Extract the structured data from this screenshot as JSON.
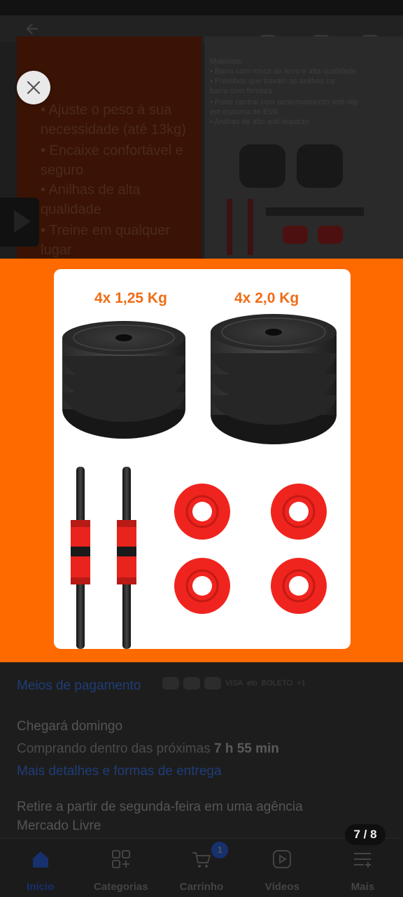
{
  "background": {
    "promo_lines": [
      "• Ajuste o peso à sua",
      "necessidade (até 13kg)",
      "• Encaixe confortável e",
      "seguro",
      "• Anilhas de alta",
      "qualidade",
      "• Treine em qualquer",
      "lugar"
    ],
    "spec_lines": [
      "Materiais:",
      "• Barra com rosca de ferro e alta qualidade",
      "• Presilhas que travam as anilhas na",
      "barra com firmeza",
      "• Parte central com acolchoamento anti-slip",
      "em espuma de EVA",
      "• Anilhas de alto anti-impacto"
    ],
    "payment_link": "Meios de pagamento",
    "payment_icons_text": [
      "VISA",
      "elo",
      "BOLETO",
      "+1"
    ],
    "delivery_title": "Chegará domingo",
    "delivery_prefix": "Comprando dentro das próximas",
    "delivery_time": "7 h 55 min",
    "delivery_link": "Mais detalhes e formas de entrega",
    "pickup_line1": "Retire a partir de segunda-feira em uma agência",
    "pickup_line2": "Mercado Livre"
  },
  "bottom_nav": {
    "items": [
      {
        "label": "Início",
        "icon": "home-icon",
        "active": true
      },
      {
        "label": "Categorias",
        "icon": "categories-icon"
      },
      {
        "label": "Carrinho",
        "icon": "cart-icon",
        "badge": "1"
      },
      {
        "label": "Vídeos",
        "icon": "video-icon"
      },
      {
        "label": "Mais",
        "icon": "more-menu-icon"
      }
    ]
  },
  "viewer": {
    "close_icon": "close-icon",
    "counter": "7 / 8",
    "image": {
      "label_left": "4x 1,25 Kg",
      "label_right": "4x 2,0 Kg"
    }
  },
  "colors": {
    "band": "#ff6a00",
    "accent_text": "#ef6c16",
    "collar_red": "#f0241e",
    "nav_active": "#17306e"
  }
}
